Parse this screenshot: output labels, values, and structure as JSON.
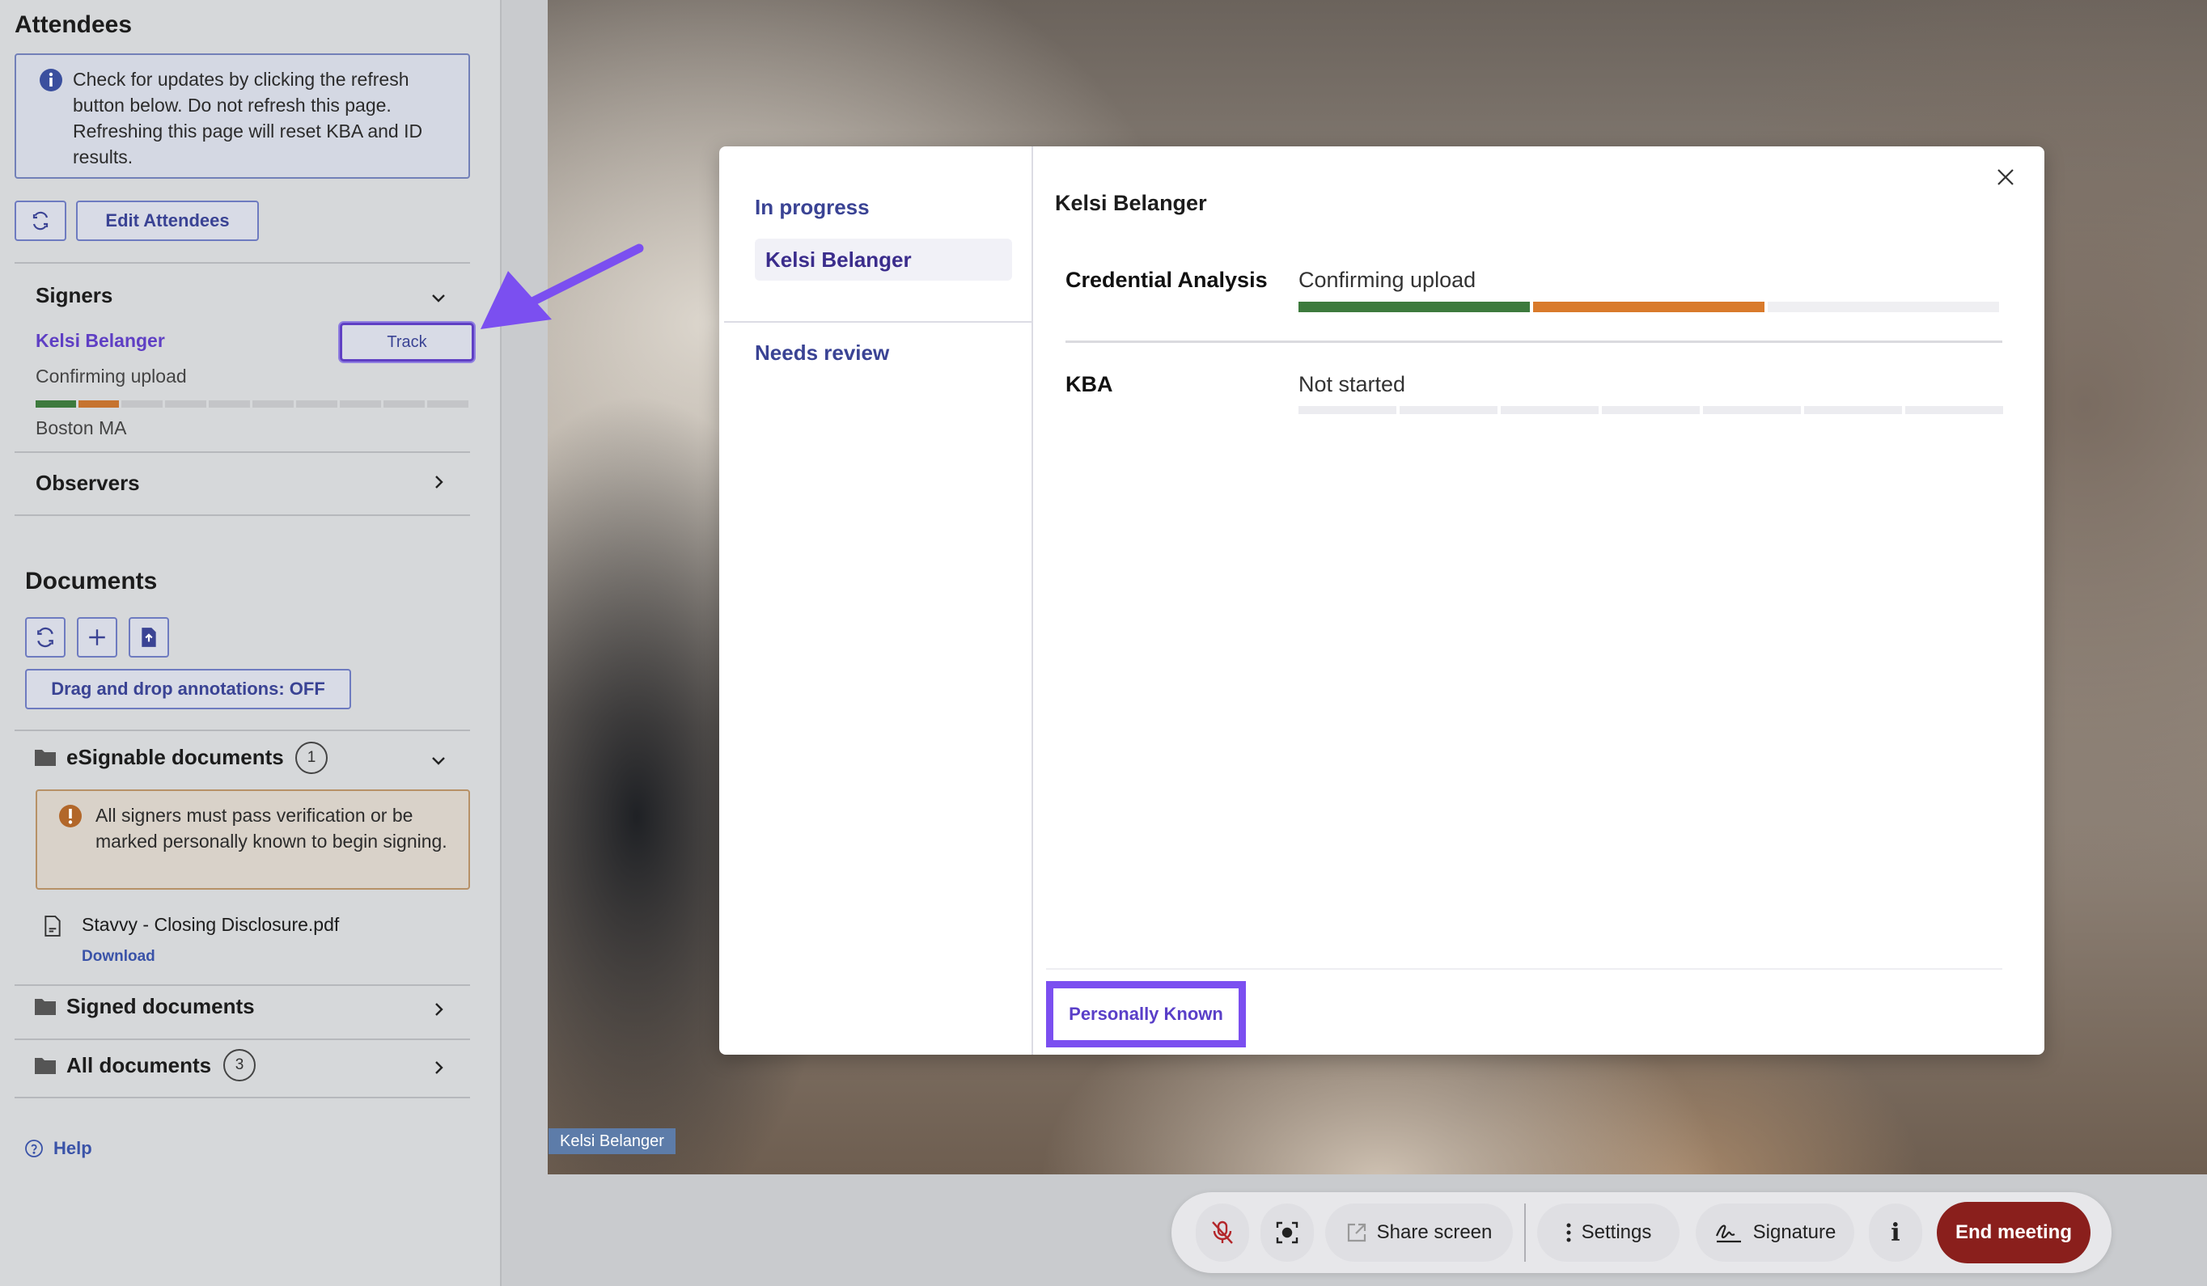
{
  "sidebar": {
    "title": "Attendees",
    "info_text": "Check for updates by clicking the refresh button below. Do not refresh this page. Refreshing this page will reset KBA and ID results.",
    "edit_attendees_label": "Edit Attendees",
    "signers_label": "Signers",
    "signer": {
      "name": "Kelsi Belanger",
      "track_label": "Track",
      "status": "Confirming upload",
      "location": "Boston MA",
      "progress_segments_done": 2,
      "progress_segments_total": 10
    },
    "observers_label": "Observers",
    "documents_title": "Documents",
    "drag_drop_label": "Drag and drop annotations: OFF",
    "esignable": {
      "label": "eSignable documents",
      "count": "1",
      "warning": "All signers must pass verification or be marked personally known to begin signing.",
      "file_name": "Stavvy - Closing Disclosure.pdf",
      "download_label": "Download"
    },
    "signed_documents_label": "Signed documents",
    "all_documents": {
      "label": "All documents",
      "count": "3"
    },
    "help_label": "Help"
  },
  "video": {
    "participant_tag": "Kelsi Belanger"
  },
  "modal": {
    "groups": {
      "in_progress_label": "In progress",
      "selected_signer": "Kelsi Belanger",
      "needs_review_label": "Needs review"
    },
    "signer_name": "Kelsi Belanger",
    "rows": [
      {
        "label": "Credential Analysis",
        "status": "Confirming upload",
        "segments_done": 2,
        "segments_total": 3
      },
      {
        "label": "KBA",
        "status": "Not started",
        "segments_done": 0,
        "segments_total": 7
      }
    ],
    "personally_known_label": "Personally Known"
  },
  "toolbar": {
    "share_screen_label": "Share screen",
    "settings_label": "Settings",
    "signature_label": "Signature",
    "info_label": "i",
    "end_meeting_label": "End meeting"
  },
  "colors": {
    "accent_purple": "#7b4ff0",
    "progress_green": "#3d7a3d",
    "progress_orange": "#d97a2b",
    "end_meeting_red": "#8a1f1c"
  }
}
